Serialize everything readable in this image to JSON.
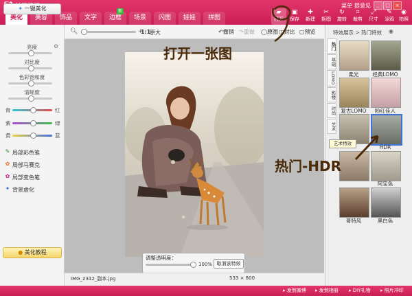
{
  "app": {
    "title": "美图秀秀 2.7.2",
    "menu_label": "菜单",
    "help_label": "提意见"
  },
  "tabs": [
    "美化",
    "美容",
    "饰品",
    "文字",
    "边框",
    "场景",
    "闪图",
    "娃娃",
    "拼图"
  ],
  "new_badge": "新",
  "tools": [
    {
      "label": "打开",
      "icon": "folder-icon"
    },
    {
      "label": "保存",
      "icon": "save-icon"
    },
    {
      "label": "新建",
      "icon": "new-icon"
    },
    {
      "label": "抠图",
      "icon": "cutout-icon"
    },
    {
      "label": "旋转",
      "icon": "rotate-icon"
    },
    {
      "label": "裁剪",
      "icon": "crop-icon"
    },
    {
      "label": "尺寸",
      "icon": "resize-icon"
    },
    {
      "label": "涂鸦",
      "icon": "brush-icon"
    },
    {
      "label": "拍照",
      "icon": "camera-icon"
    }
  ],
  "left": {
    "one_key": "一键美化",
    "adjust": [
      {
        "label": "亮度",
        "level": 0.5
      },
      {
        "label": "对比度",
        "level": 0.5
      },
      {
        "label": "色彩饱和度",
        "level": 0.5
      },
      {
        "label": "清晰度",
        "level": 0.5
      }
    ],
    "colors": [
      {
        "left": "青",
        "right": "红",
        "level": 0.5
      },
      {
        "left": "紫",
        "right": "绿",
        "level": 0.5
      },
      {
        "left": "黄",
        "right": "蓝",
        "level": 0.5
      }
    ],
    "links": [
      "局部彩色笔",
      "局部马赛克",
      "局部变色笔",
      "背景虚化"
    ],
    "tutorial": "美化教程"
  },
  "center": {
    "zoom_ratio": "1:1",
    "original_size": "原大",
    "undo": "撤销",
    "redo": "重做",
    "original_image": "原图",
    "compare": "对比",
    "preview": "预览",
    "opacity_label": "调整透明度：",
    "opacity_value": "100%",
    "cancel_effect": "取消该特效",
    "filename": "IMG_2342_副本.jpg",
    "dimensions": "533 × 800"
  },
  "right": {
    "breadcrumb": "特效展示 > 热门特效",
    "side_tabs": [
      "热门",
      "基础",
      "LOMO",
      "影楼",
      "时尚",
      "艺术"
    ],
    "tooltip": "艺术特效",
    "effects": [
      "柔光",
      "经典LOMO",
      "复古LOMO",
      "粉红佳人",
      "",
      "HDR",
      "",
      "阿宝色",
      "哥特风",
      "黑白色"
    ]
  },
  "annotations": {
    "open": "打开一张图",
    "hdr": "热门-HDR"
  },
  "bottom": [
    "发到微博",
    "发到相册",
    "DIY礼物",
    "照片冲印"
  ],
  "colors": {
    "brand": "#d2225d",
    "tab_active_text": "#d2225d"
  }
}
